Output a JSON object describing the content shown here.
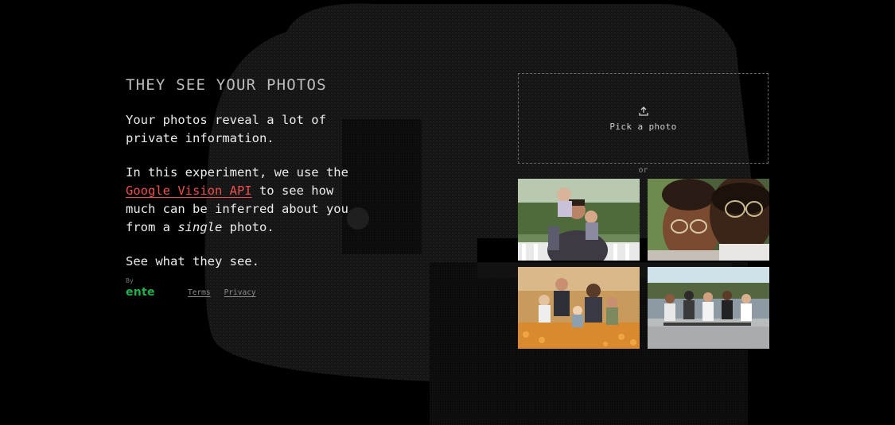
{
  "hero": {
    "title": "THEY SEE YOUR PHOTOS",
    "para1": "Your photos reveal a lot of private information.",
    "para2_before": "In this experiment, we use the ",
    "para2_link": "Google Vision API",
    "para2_middle": " to see how much can be inferred about you from a ",
    "para2_italic": "single",
    "para2_after": " photo.",
    "para3": "See what they see."
  },
  "footer": {
    "by_label": "By",
    "brand": "ente",
    "terms": "Terms",
    "privacy": "Privacy"
  },
  "upload": {
    "label": "Pick a photo",
    "icon": "upload-icon"
  },
  "or_label": "or",
  "sample_photos": [
    {
      "subject": "family with two children on shoulders outdoors"
    },
    {
      "subject": "close-up of two people with glasses"
    },
    {
      "subject": "family sitting in a flower field"
    },
    {
      "subject": "group of skateboarders sitting on a ledge"
    }
  ],
  "colors": {
    "background": "#000000",
    "link": "#ef4e4e",
    "brand": "#21b14a",
    "text": "#ececec",
    "title": "#bdbdbd"
  }
}
